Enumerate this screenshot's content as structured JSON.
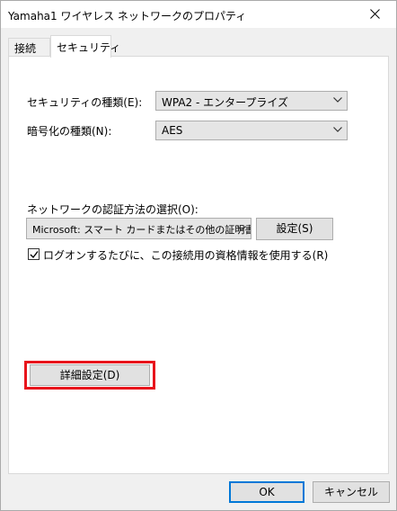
{
  "window": {
    "title": "Yamaha1 ワイヤレス ネットワークのプロパティ"
  },
  "tabs": [
    {
      "label": "接続"
    },
    {
      "label": "セキュリティ"
    }
  ],
  "security": {
    "type_label": "セキュリティの種類(E):",
    "type_value": "WPA2 - エンタープライズ",
    "encryption_label": "暗号化の種類(N):",
    "encryption_value": "AES",
    "auth_method_label": "ネットワークの認証方法の選択(O):",
    "auth_method_value": "Microsoft: スマート カードまたはその他の証明書",
    "settings_button": "設定(S)",
    "remember_label": "ログオンするたびに、この接続用の資格情報を使用する(R)",
    "remember_checked": true,
    "advanced_button": "詳細設定(D)"
  },
  "buttons": {
    "ok": "OK",
    "cancel": "キャンセル"
  },
  "colors": {
    "highlight": "#e8141b",
    "default_button_border": "#0078d7"
  }
}
